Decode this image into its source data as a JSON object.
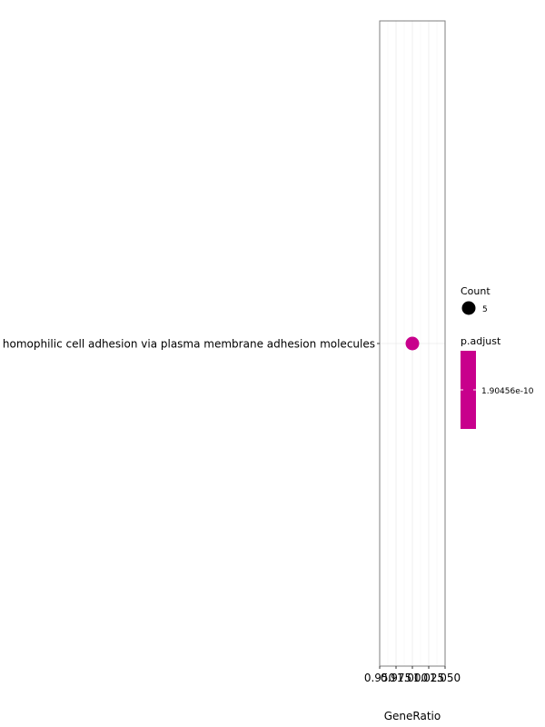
{
  "chart_data": {
    "type": "scatter",
    "title": "",
    "xlabel": "GeneRatio",
    "ylabel": "",
    "xlim": [
      0.95,
      1.05
    ],
    "x_ticks": [
      0.95,
      0.975,
      1.0,
      1.025,
      1.05
    ],
    "x_tick_labels": [
      "0.950",
      "0.975",
      "1.000",
      "1.025",
      "1.050"
    ],
    "grid": true,
    "categories": [
      "homophilic cell adhesion via plasma membrane adhesion molecules"
    ],
    "points": [
      {
        "term": "homophilic cell adhesion via plasma membrane adhesion molecules",
        "gene_ratio": 1.0,
        "count": 5,
        "p_adjust": 1.90456e-10
      }
    ],
    "legend": {
      "placement": "right",
      "size_title": "Count",
      "size_entries": [
        "5"
      ],
      "color_title": "p.adjust",
      "color_labels": [
        "1.90456e-10"
      ],
      "color": "#C8008C"
    }
  }
}
